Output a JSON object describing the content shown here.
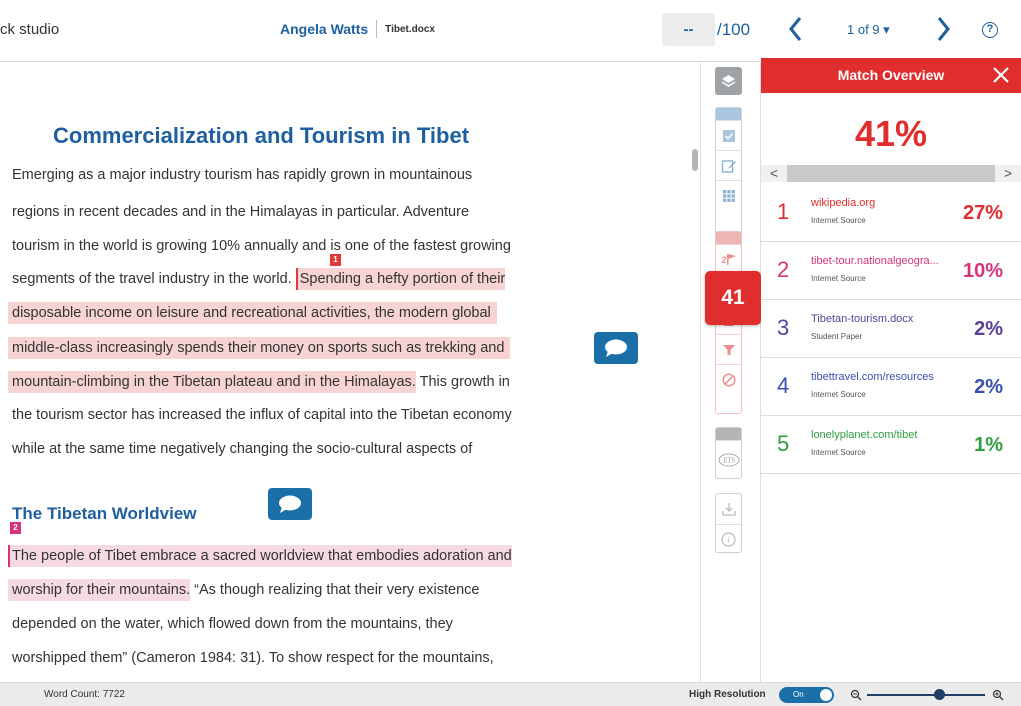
{
  "header": {
    "brand": "ck studio",
    "author": "Angela Watts",
    "document": "Tibet.docx",
    "score_value": "--",
    "score_max": "/100",
    "page_indicator": "1 of 9 ▾",
    "help": "?"
  },
  "document": {
    "title": "Commercialization and Tourism in Tibet",
    "p1": {
      "l1": "Emerging as a major industry tourism has rapidly grown in mountainous",
      "l2": "regions in recent decades and in the Himalayas in particular. Adventure",
      "l3": "tourism in the world is growing 10% annually and is one of the fastest growing",
      "l4_plain": "segments of the travel industry in the world. ",
      "l4_hl": "Spending a hefty portion of their",
      "l5_hl": "disposable income on leisure and recreational activities, the modern global",
      "l6_hl": "middle-class increasingly spends their money on sports such as trekking and",
      "l7_hl": "mountain-climbing in the Tibetan plateau and in the Himalayas.",
      "l7_plain": " This growth in",
      "l8": "the tourism sector has increased the influx of capital into the Tibetan economy",
      "l9": "while at the same time negatively changing the socio-cultural aspects of"
    },
    "subheading": "The Tibetan Worldview",
    "p2": {
      "l1_hl": "The people of Tibet embrace a sacred worldview that embodies adoration and",
      "l2_hl": "worship for their mountains.",
      "l2_plain": " “As though realizing that their very existence",
      "l3": "depended on the water, which flowed down from the mountains, they",
      "l4": "worshipped them” (Cameron 1984: 31). To show respect for the mountains,"
    },
    "marker1": "1",
    "marker2": "2"
  },
  "toolbar": {
    "flag_count": "2",
    "match_badge": "41"
  },
  "panel": {
    "title": "Match Overview",
    "total": "41%",
    "scroll_left": "<",
    "scroll_right": ">",
    "matches": [
      {
        "num": "1",
        "source": "wikipedia.org",
        "type": "Internet Source",
        "pct": "27%",
        "color": "#e02d2d"
      },
      {
        "num": "2",
        "source": "tibet-tour.nationalgeogra...",
        "type": "Internet Source",
        "pct": "10%",
        "color": "#d6347a"
      },
      {
        "num": "3",
        "source": "Tibetan-tourism.docx",
        "type": "Student Paper",
        "pct": "2%",
        "color": "#5a3f99"
      },
      {
        "num": "4",
        "source": "tibettravel.com/resources",
        "type": "Internet Source",
        "pct": "2%",
        "color": "#3a4fb0"
      },
      {
        "num": "5",
        "source": "lonelyplanet.com/tibet",
        "type": "Internet Source",
        "pct": "1%",
        "color": "#2f9e3f"
      }
    ]
  },
  "status": {
    "word_count": "Word Count: 7722",
    "high_res_label": "High Resolution",
    "toggle_state": "On",
    "zoom_level": 0.6
  },
  "colors": {
    "accent_blue": "#1f5fa0",
    "match_red": "#e02d2d",
    "bubble_blue": "#1a6fa8"
  }
}
